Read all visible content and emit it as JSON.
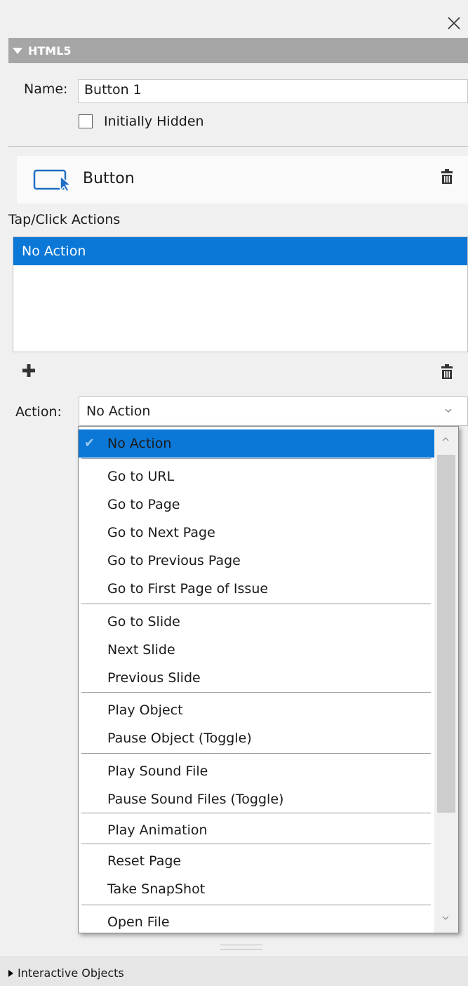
{
  "header": {
    "title": "HTML5"
  },
  "properties": {
    "name_label": "Name:",
    "name_value": "Button 1",
    "initially_hidden_label": "Initially Hidden"
  },
  "object": {
    "type_label": "Button"
  },
  "tap_actions": {
    "label": "Tap/Click Actions",
    "items": [
      "No Action"
    ]
  },
  "action": {
    "label": "Action:",
    "selected": "No Action"
  },
  "dropdown": {
    "items": [
      "No Action",
      "Go to URL",
      "Go to Page",
      "Go to Next Page",
      "Go to Previous Page",
      "Go to First Page of Issue",
      "Go to Slide",
      "Next Slide",
      "Previous Slide",
      "Play Object",
      "Pause Object (Toggle)",
      "Play Sound File",
      "Pause Sound Files (Toggle)",
      "Play Animation",
      "Reset Page",
      "Take SnapShot",
      "Open File"
    ]
  },
  "footer": {
    "interactive_objects_label": "Interactive Objects"
  },
  "colors": {
    "selection": "#0b78d7",
    "header_bg": "#a6a6a6"
  }
}
